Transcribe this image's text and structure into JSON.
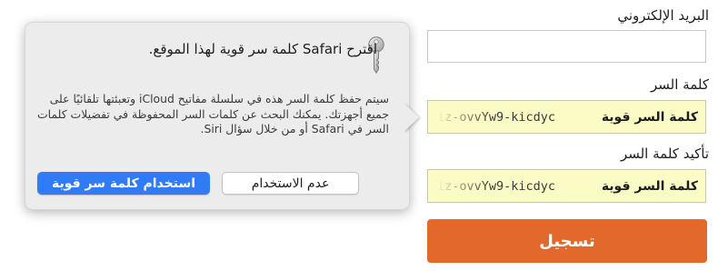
{
  "form": {
    "email_label": "البريد الإلكتروني",
    "email_value": "",
    "password_label": "كلمة السر",
    "password_tag": "كلمة السر قوية",
    "password_value": "iz-ovvYw9-kicdyc",
    "confirm_label": "تأكيد كلمة السر",
    "confirm_tag": "كلمة السر قوية",
    "confirm_value": "iz-ovvYw9-kicdyc",
    "submit_label": "تسجيل"
  },
  "popover": {
    "title": "اقترح Safari كلمة سر قوية لهذا الموقع.",
    "body": "سيتم حفظ كلمة السر هذه في سلسلة مفاتيح iCloud وتعبئتها تلقائيًا على جميع أجهزتك. يمكنك البحث عن كلمات السر المحفوظة في تفضيلات كلمات السر في Safari أو من خلال سؤال Siri.",
    "primary_button": "استخدام كلمة سر قوية",
    "secondary_button": "عدم الاستخدام",
    "icon": "key-icon"
  },
  "colors": {
    "accent": "#2f7cf6",
    "submit": "#e2682b",
    "autofill_background": "#fbfbc6",
    "popover_background": "#ececec"
  }
}
